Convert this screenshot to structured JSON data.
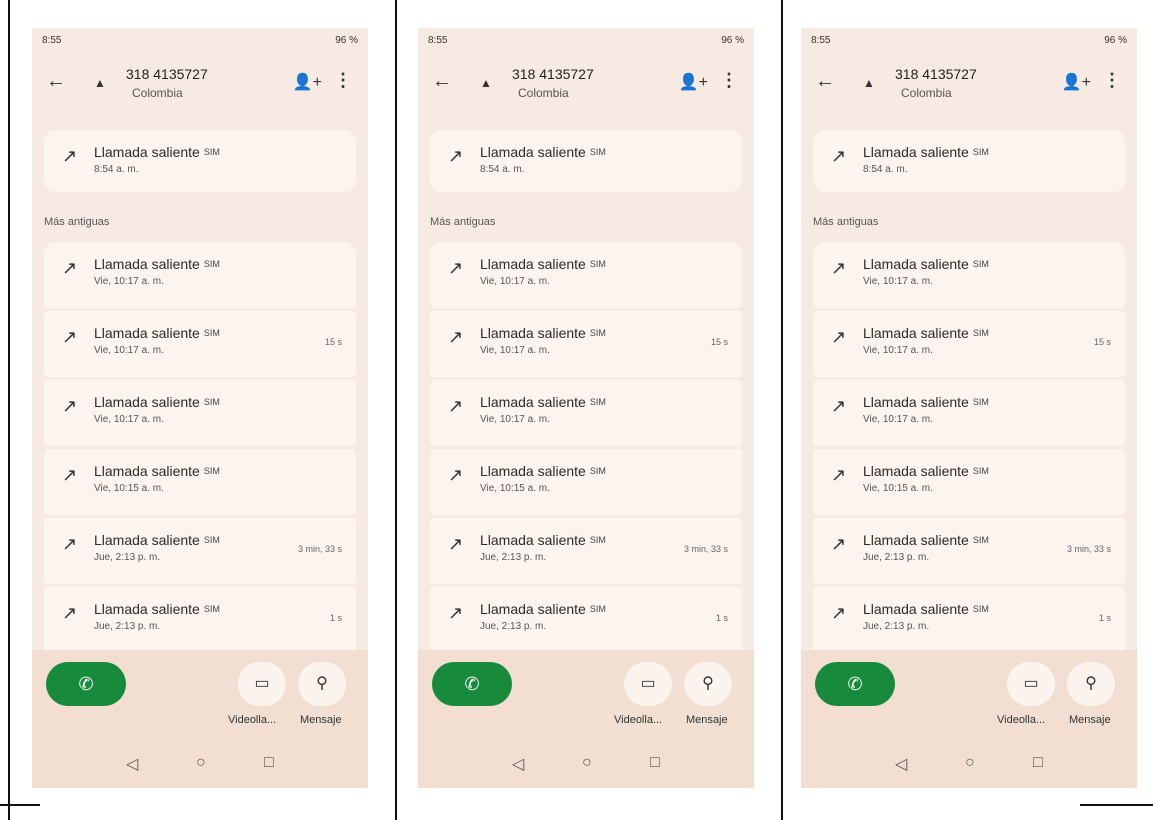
{
  "status": {
    "time": "8:55",
    "right": "96 %"
  },
  "header": {
    "number": "318 4135727",
    "country": "Colombia",
    "back_icon": "←",
    "person_icon": "▲",
    "add_contact_icon": "👤+",
    "more_icon": "⋮"
  },
  "call_arrow": "↗",
  "sim_label": "SIM",
  "section": "Más antiguas",
  "calls": [
    {
      "title": "Llamada saliente",
      "time": "8:54 a. m.",
      "duration": ""
    },
    {
      "title": "Llamada saliente",
      "time": "Vie, 10:17 a. m.",
      "duration": ""
    },
    {
      "title": "Llamada saliente",
      "time": "Vie, 10:17 a. m.",
      "duration": "15 s"
    },
    {
      "title": "Llamada saliente",
      "time": "Vie, 10:17 a. m.",
      "duration": ""
    },
    {
      "title": "Llamada saliente",
      "time": "Vie, 10:15 a. m.",
      "duration": ""
    },
    {
      "title": "Llamada saliente",
      "time": "Jue, 2:13 p. m.",
      "duration": "3 min, 33 s"
    },
    {
      "title": "Llamada saliente",
      "time": "Jue, 2:13 p. m.",
      "duration": "1 s"
    }
  ],
  "actions": {
    "call_icon": "✆",
    "video_icon": "▭",
    "message_icon": "⚲",
    "video_label": "Videolla...",
    "message_label": "Mensaje"
  },
  "nav": {
    "back": "◁",
    "home": "○",
    "recents": "□"
  },
  "colors": {
    "accent": "#178a3b",
    "background": "#f7eae3"
  }
}
